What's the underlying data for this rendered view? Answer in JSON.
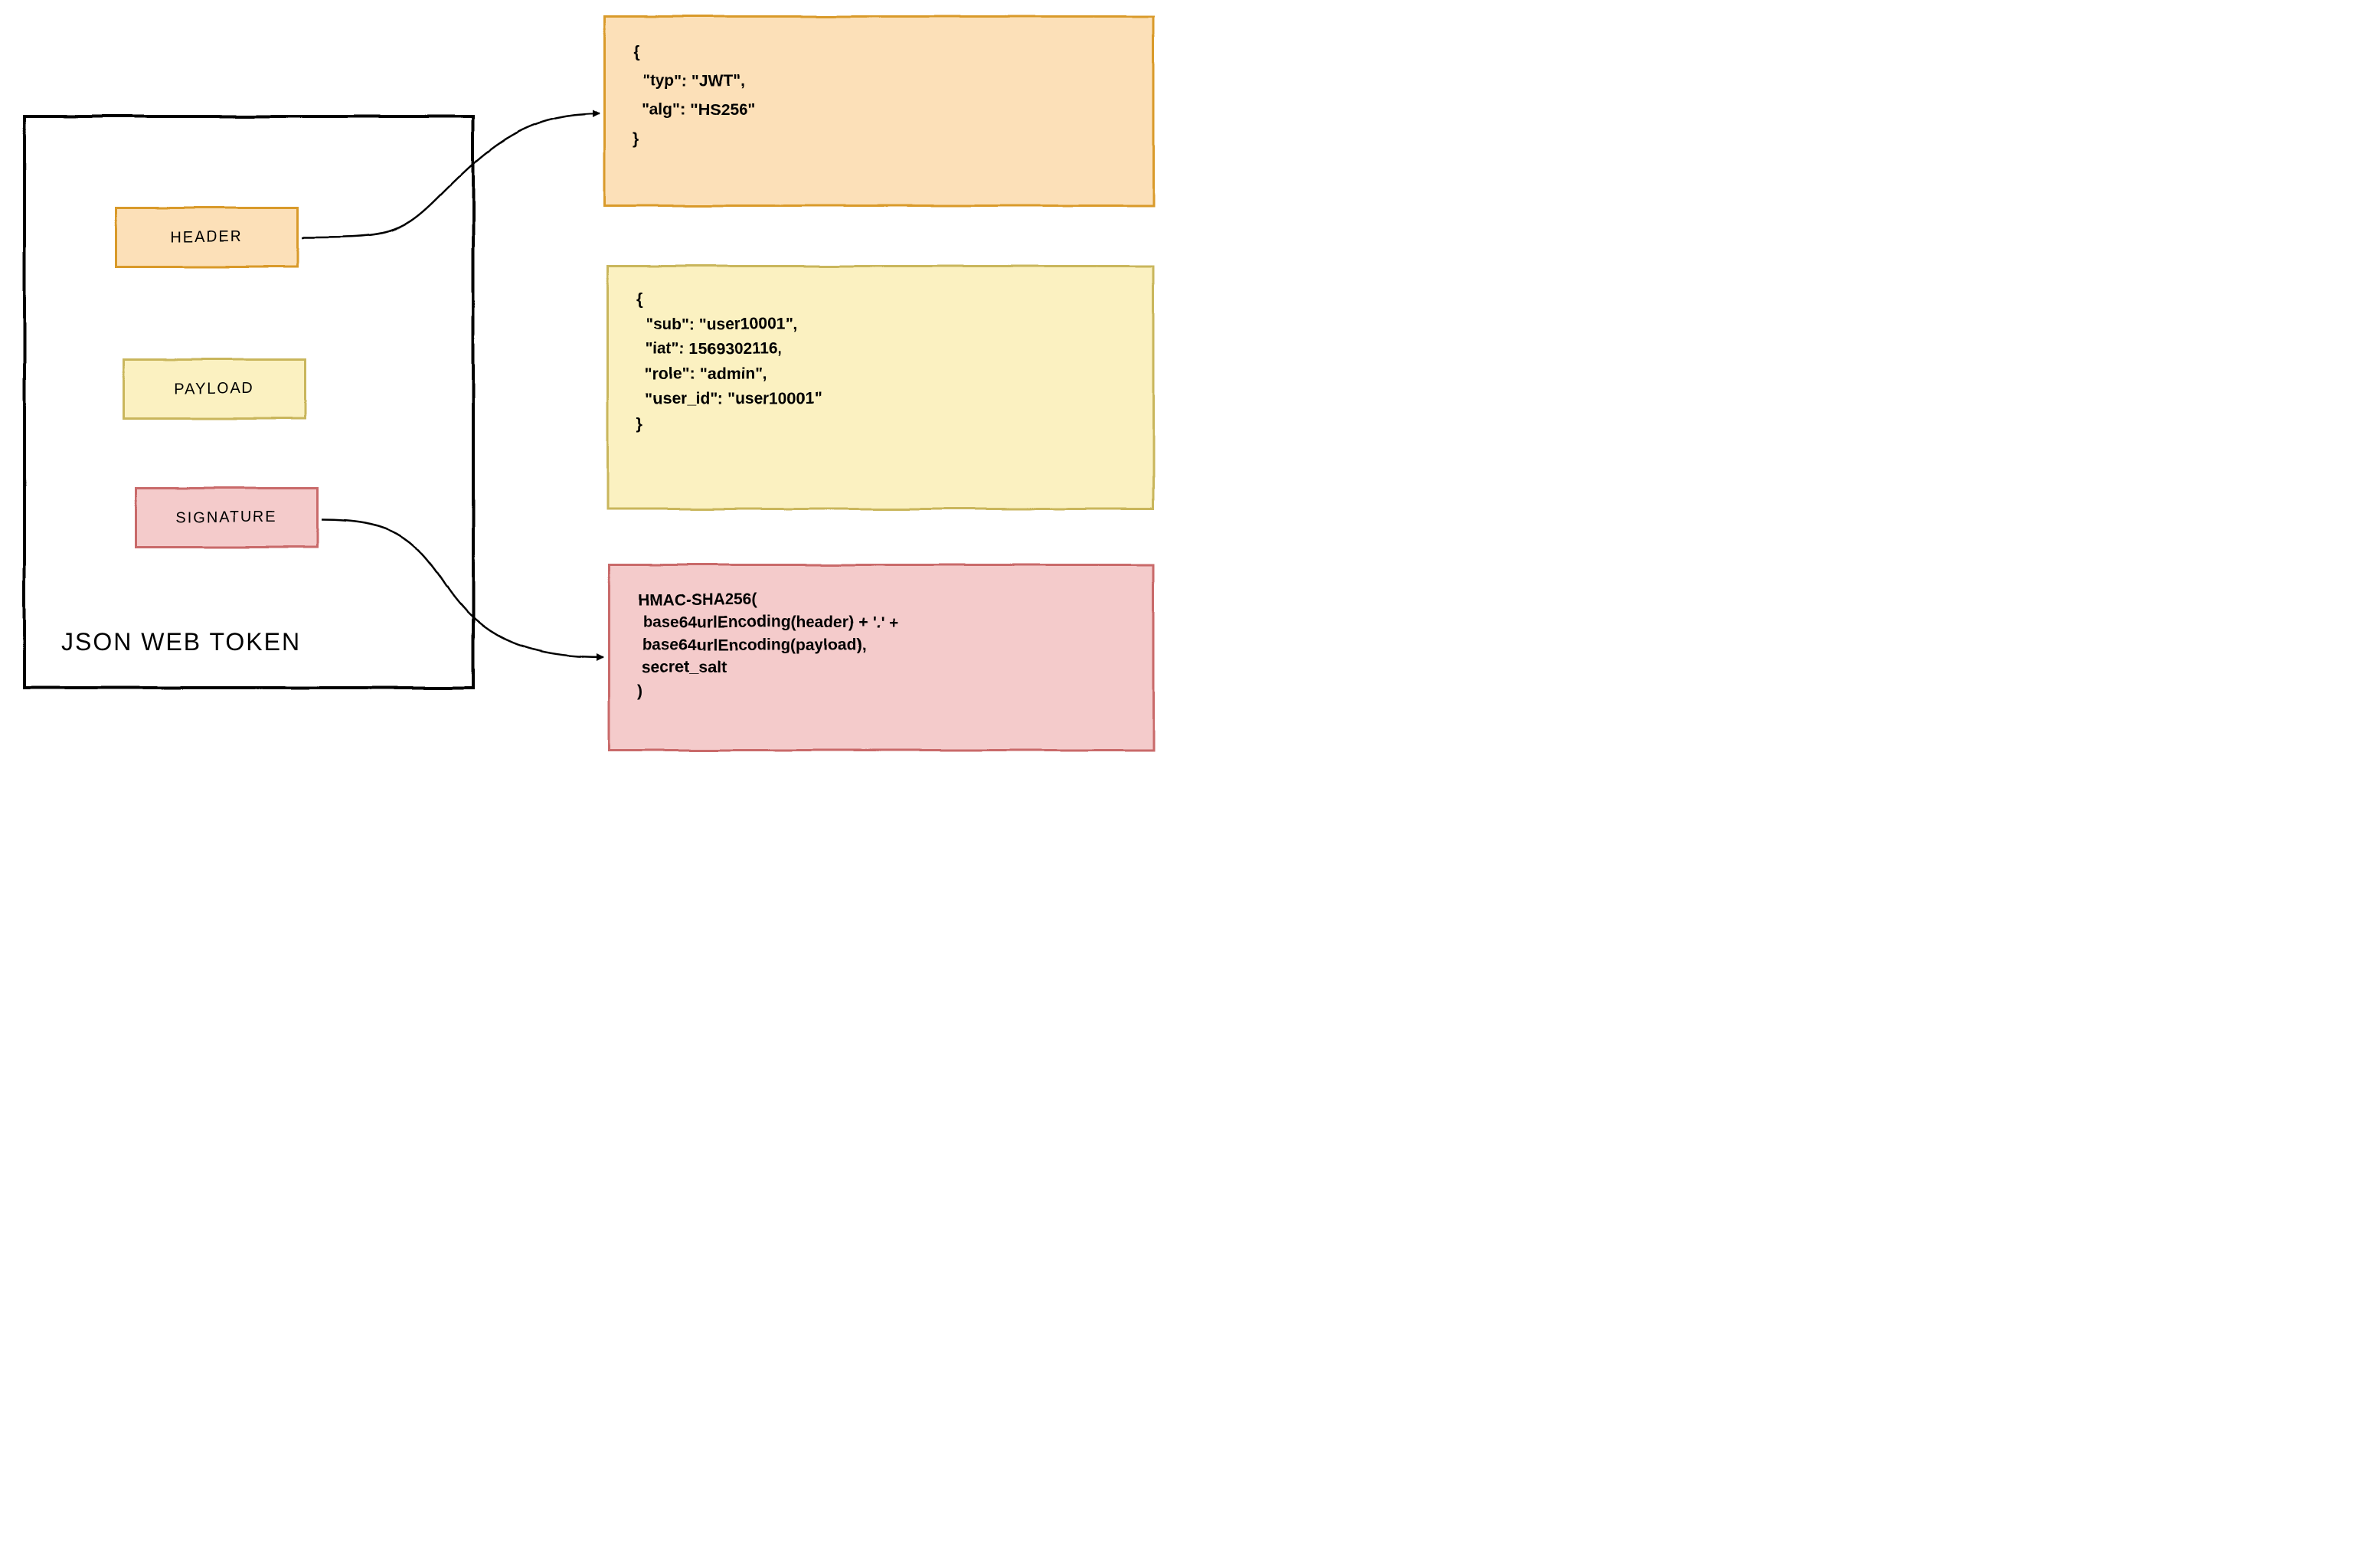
{
  "title": "JSON WEB TOKEN",
  "parts": {
    "header": {
      "label": "HEADER",
      "color": {
        "fill": "#FCE0B8",
        "border": "#D99A2B"
      },
      "content": "{\n  \"typ\": \"JWT\",\n  \"alg\": \"HS256\"\n}"
    },
    "payload": {
      "label": "PAYLOAD",
      "color": {
        "fill": "#FBF1C1",
        "border": "#C9B65B"
      },
      "content": "{\n  \"sub\": \"user10001\",\n  \"iat\": 1569302116,\n  \"role\": \"admin\",\n  \"user_id\": \"user10001\"\n}"
    },
    "signature": {
      "label": "SIGNATURE",
      "color": {
        "fill": "#F4CBCB",
        "border": "#C96A6A"
      },
      "content": "HMAC-SHA256(\n base64urlEncoding(header) + '.' +\n base64urlEncoding(payload),\n secret_salt\n)"
    }
  },
  "arrows": [
    {
      "from": "header",
      "to": "header-content"
    },
    {
      "from": "payload",
      "to": "payload-content"
    },
    {
      "from": "signature",
      "to": "signature-content"
    }
  ]
}
